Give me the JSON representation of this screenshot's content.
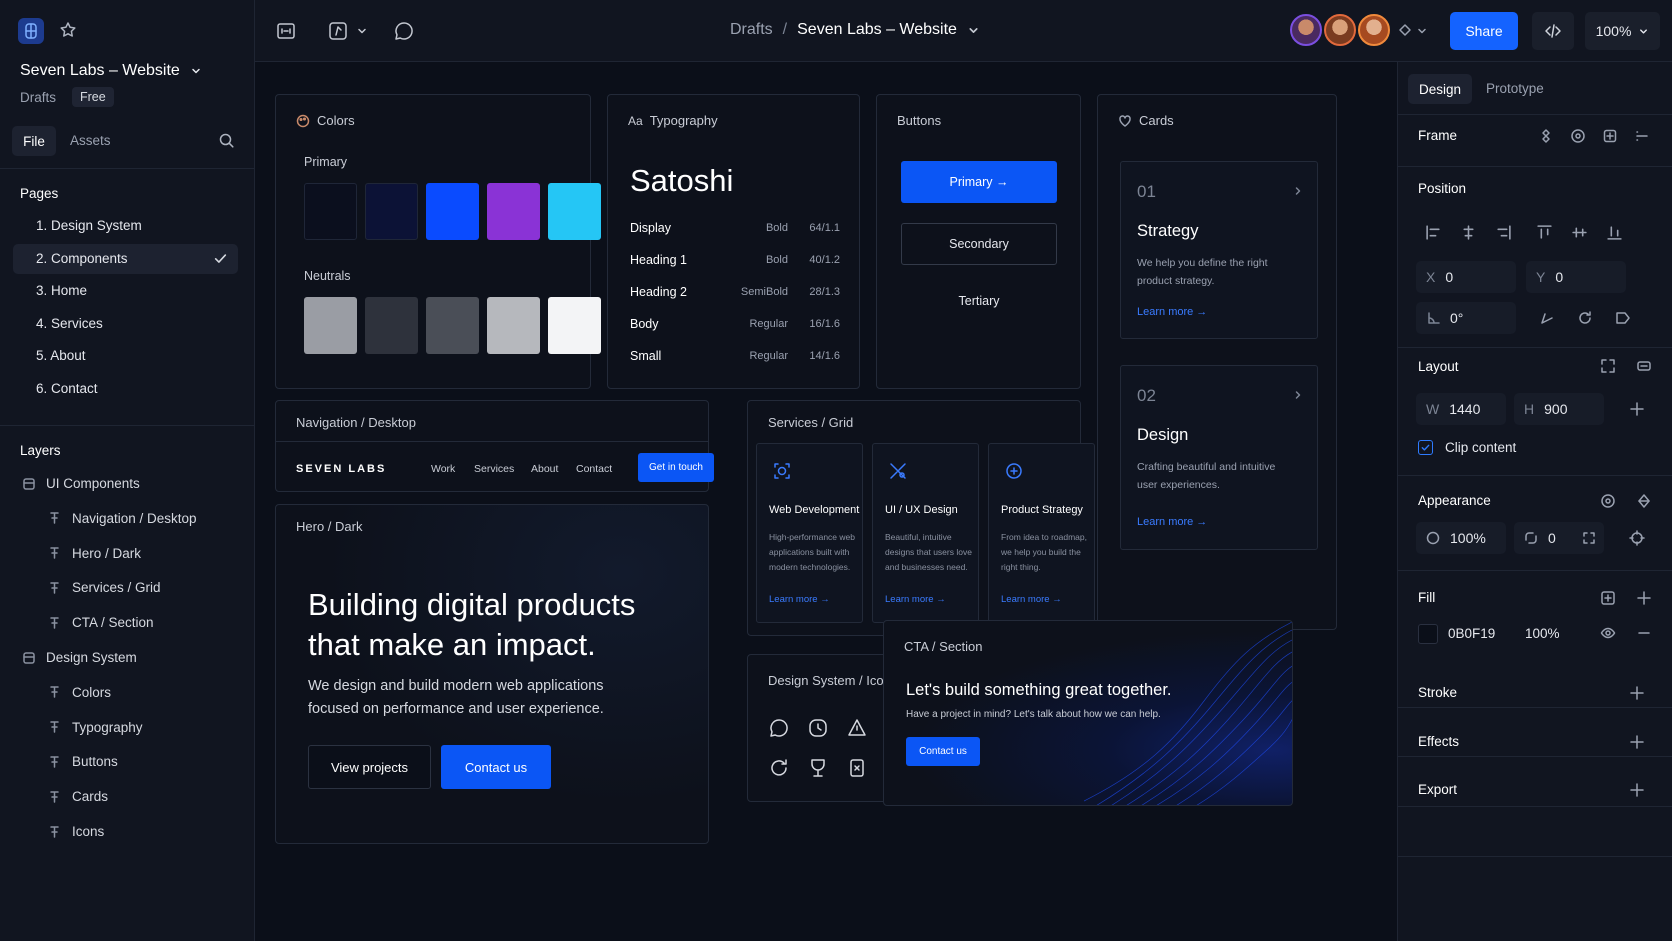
{
  "file": {
    "name": "Seven Labs – Website",
    "location": "Drafts",
    "plan": "Free"
  },
  "left_tabs": {
    "file": "File",
    "assets": "Assets"
  },
  "pages": {
    "title": "Pages",
    "items": [
      "1. Design System",
      "2. Components",
      "3. Home",
      "4. Services",
      "5. About",
      "6. Contact"
    ]
  },
  "layers": {
    "title": "Layers",
    "groups": [
      {
        "label": "UI Components",
        "children": [
          "Navigation / Desktop",
          "Hero / Dark",
          "Services / Grid",
          "CTA / Section"
        ]
      },
      {
        "label": "Design System",
        "children": [
          "Colors",
          "Typography",
          "Buttons",
          "Cards",
          "Icons"
        ]
      }
    ]
  },
  "topbar": {
    "breadcrumb_parent": "Drafts",
    "breadcrumb_sep": "/",
    "breadcrumb_current": "Seven Labs – Website",
    "share": "Share",
    "zoom": "100%"
  },
  "colors_frame": {
    "title": "Colors",
    "primary_label": "Primary",
    "neutrals_label": "Neutrals",
    "primary": [
      "#0b0f1e",
      "#0c1236",
      "#0a4bff",
      "#8a33d6",
      "#25c6f5"
    ],
    "neutrals": [
      "#9a9da4",
      "#2e323c",
      "#4a4e57",
      "#b6b8bd",
      "#f3f4f6"
    ]
  },
  "typography_frame": {
    "title": "Typography",
    "title_prefix": "Aa",
    "font": "Satoshi",
    "rows": [
      {
        "name": "Display",
        "weight": "Bold",
        "size": "64/1.1"
      },
      {
        "name": "Heading 1",
        "weight": "Bold",
        "size": "40/1.2"
      },
      {
        "name": "Heading 2",
        "weight": "SemiBold",
        "size": "28/1.3"
      },
      {
        "name": "Body",
        "weight": "Regular",
        "size": "16/1.6"
      },
      {
        "name": "Small",
        "weight": "Regular",
        "size": "14/1.6"
      }
    ]
  },
  "buttons_frame": {
    "title": "Buttons",
    "primary": "Primary →",
    "secondary": "Secondary",
    "tertiary": "Tertiary"
  },
  "cards_frame": {
    "title": "Cards",
    "cards": [
      {
        "num": "01",
        "title": "Strategy",
        "text": "We help you define the right product strategy.",
        "link": "Learn more →"
      },
      {
        "num": "02",
        "title": "Design",
        "text": "Crafting beautiful and intuitive user experiences.",
        "link": "Learn more →"
      }
    ]
  },
  "nav_frame": {
    "title": "Navigation / Desktop",
    "logo": "SEVEN LABS",
    "links": [
      "Work",
      "Services",
      "About",
      "Contact"
    ],
    "cta": "Get in touch"
  },
  "hero_frame": {
    "title": "Hero / Dark",
    "heading": "Building digital products that make an impact.",
    "text": "We design and build modern web applications focused on performance and user experience.",
    "btn1": "View projects",
    "btn2": "Contact us"
  },
  "services_frame": {
    "title": "Services / Grid",
    "items": [
      {
        "title": "Web Development",
        "text": "High-performance web applications built with modern technologies.",
        "link": "Learn more →"
      },
      {
        "title": "UI / UX Design",
        "text": "Beautiful, intuitive designs that users love and businesses need.",
        "link": "Learn more →"
      },
      {
        "title": "Product Strategy",
        "text": "From idea to roadmap, we help you build the right thing.",
        "link": "Learn more →"
      }
    ]
  },
  "icons_frame": {
    "title": "Design System / Icons"
  },
  "cta_frame": {
    "title": "CTA / Section",
    "heading": "Let's build something great together.",
    "text": "Have a project in mind? Let's talk about how we can help.",
    "button": "Contact us"
  },
  "right_panel": {
    "tabs": {
      "design": "Design",
      "prototype": "Prototype"
    },
    "frame_label": "Frame",
    "position_label": "Position",
    "x_label": "X",
    "x": "0",
    "y_label": "Y",
    "y": "0",
    "rotation": "0°",
    "layout_label": "Layout",
    "w_label": "W",
    "w": "1440",
    "h_label": "H",
    "h": "900",
    "clip": "Clip content",
    "appearance_label": "Appearance",
    "opacity": "100%",
    "radius": "0",
    "fill_label": "Fill",
    "fill_hex": "0B0F19",
    "fill_opacity": "100%",
    "fill_color": "#0b0f19",
    "stroke_label": "Stroke",
    "effects_label": "Effects",
    "export_label": "Export"
  }
}
